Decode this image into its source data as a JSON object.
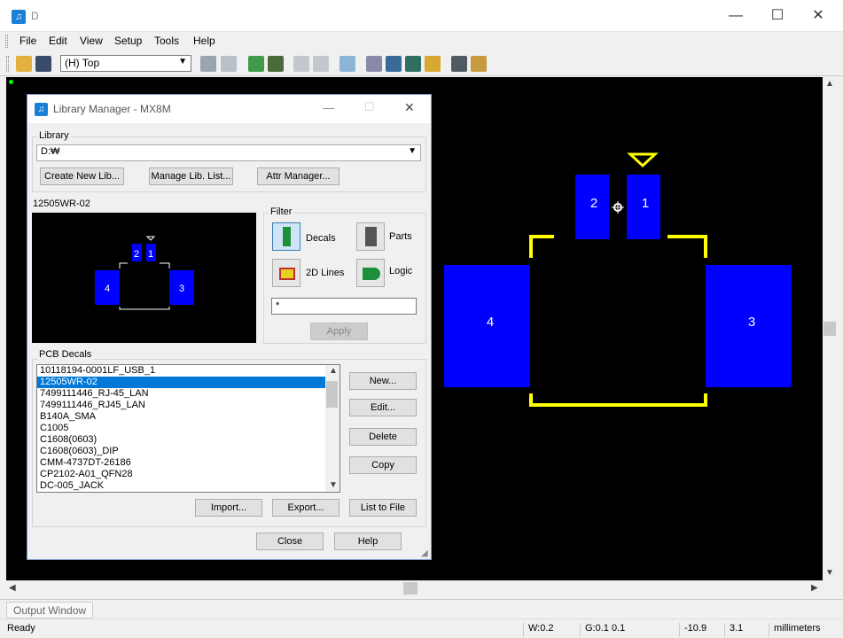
{
  "window": {
    "title": "D",
    "minimize": "—",
    "maximize": "☐",
    "close": "✕"
  },
  "menu": [
    "File",
    "Edit",
    "View",
    "Setup",
    "Tools",
    "Help"
  ],
  "toolbar": {
    "layer": "(H) Top"
  },
  "dialog": {
    "title": "Library Manager - MX8M",
    "library_label": "Library",
    "library_path": "D:₩",
    "buttons": {
      "create_new_lib": "Create New Lib...",
      "manage_lib_list": "Manage Lib. List...",
      "attr_manager": "Attr Manager..."
    },
    "preview_title": "12505WR-02",
    "filter": {
      "label": "Filter",
      "decals": "Decals",
      "parts": "Parts",
      "lines2d": "2D Lines",
      "logic": "Logic",
      "pattern": "*",
      "apply": "Apply"
    },
    "pcb_decals_label": "PCB Decals",
    "decals": [
      "10118194-0001LF_USB_1",
      "12505WR-02",
      "7499111446_RJ-45_LAN",
      "7499111446_RJ45_LAN",
      "B140A_SMA",
      "C1005",
      "C1608(0603)",
      "C1608(0603)_DIP",
      "CMM-4737DT-26186",
      "CP2102-A01_QFN28",
      "DC-005_JACK"
    ],
    "selected_index": 1,
    "side_buttons": {
      "new": "New...",
      "edit": "Edit...",
      "delete": "Delete",
      "copy": "Copy"
    },
    "bottom_buttons": {
      "import": "Import...",
      "export": "Export...",
      "list_to_file": "List to File"
    },
    "close": "Close",
    "help": "Help",
    "dialog_buttons": {
      "minimize": "—",
      "maximize": "☐",
      "close": "✕"
    }
  },
  "footprint": {
    "pads": [
      "2",
      "1",
      "4",
      "3"
    ]
  },
  "output_window": "Output Window",
  "status": {
    "ready": "Ready",
    "width": "W:0.2",
    "grid": "G:0.1 0.1",
    "x": "-10.9",
    "y": "3.1",
    "units": "millimeters"
  },
  "colors": {
    "pad": "#0000ff",
    "silkscreen": "#ffff00",
    "canvas": "#000000",
    "selection": "#0078d7"
  }
}
